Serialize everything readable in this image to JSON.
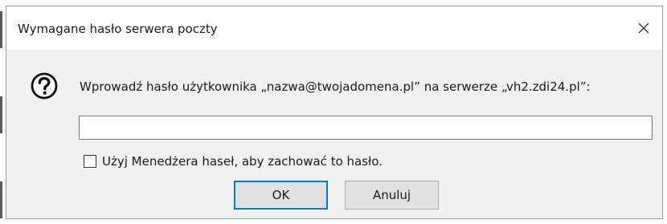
{
  "dialog": {
    "title": "Wymagane hasło serwera poczty",
    "prompt": "Wprowadź hasło użytkownika „nazwa@twojadomena.pl” na serwerze „vh2.zdi24.pl”:",
    "password_value": "",
    "remember_checkbox": {
      "label": "Użyj Menedżera haseł, aby zachować to hasło.",
      "checked": false
    },
    "buttons": {
      "ok": "OK",
      "cancel": "Anuluj"
    }
  },
  "icons": {
    "close": "close-icon",
    "question": "question-icon"
  },
  "colors": {
    "dialog_bg": "#f0f0f0",
    "titlebar_bg": "#ffffff",
    "default_button_border": "#0078d7",
    "button_bg": "#e1e1e1"
  }
}
